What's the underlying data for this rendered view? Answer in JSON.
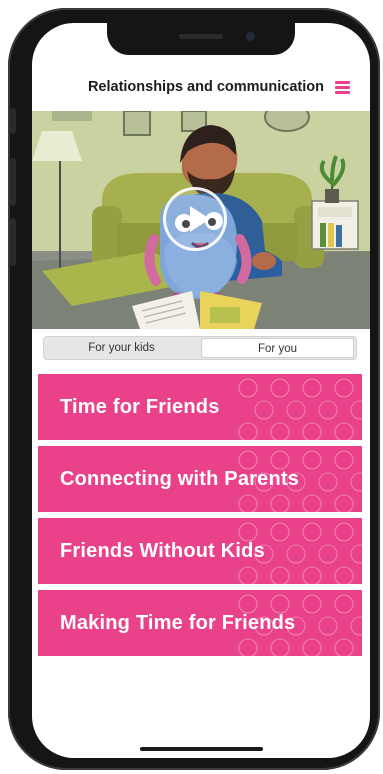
{
  "header": {
    "title": "Relationships and communication",
    "menu_icon": "hamburger-menu-icon",
    "accent_color": "#ea3f8b"
  },
  "video": {
    "play_icon": "play-icon",
    "scene": "illustration-father-reading-with-monster"
  },
  "tabs": [
    {
      "label": "For your kids",
      "selected": false
    },
    {
      "label": "For you",
      "selected": true
    }
  ],
  "cards": [
    {
      "label": "Time for Friends"
    },
    {
      "label": "Connecting with Parents"
    },
    {
      "label": "Friends Without Kids"
    },
    {
      "label": "Making Time for Friends"
    }
  ],
  "colors": {
    "card_background": "#e9418a",
    "card_text": "#ffffff",
    "phone_frame": "#151515"
  }
}
